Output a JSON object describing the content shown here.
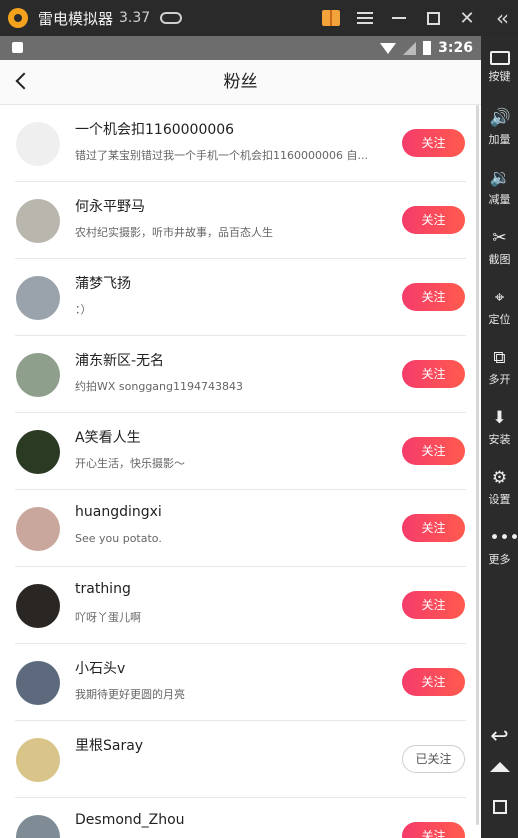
{
  "window": {
    "title": "雷电模拟器",
    "version": "3.37"
  },
  "status_bar": {
    "time": "3:26"
  },
  "header": {
    "title": "粉丝",
    "back_icon": "chevron-left-icon"
  },
  "followers": [
    {
      "name": "一个机会扣1160000006",
      "desc": "错过了某宝别错过我一个手机一个机会扣1160000006 自...",
      "button": "关注",
      "followed": false,
      "avatar_color": "#efefef"
    },
    {
      "name": "何永平野马",
      "desc": "农村纪实摄影，听市井故事，品百态人生",
      "button": "关注",
      "followed": false,
      "avatar_color": "#b9b6ae"
    },
    {
      "name": "蒲梦飞扬",
      "desc": "：）",
      "button": "关注",
      "followed": false,
      "avatar_color": "#9aa2ac"
    },
    {
      "name": "浦东新区-无名",
      "desc": "约拍WX  songgang1194743843",
      "button": "关注",
      "followed": false,
      "avatar_color": "#8ea08c"
    },
    {
      "name": "A笑看人生",
      "desc": "开心生活，快乐摄影～",
      "button": "关注",
      "followed": false,
      "avatar_color": "#2b3a22"
    },
    {
      "name": "huangdingxi",
      "desc": "See you potato.",
      "button": "关注",
      "followed": false,
      "avatar_color": "#c9a79c"
    },
    {
      "name": "trathing",
      "desc": "吖呀丫蛋儿啊",
      "button": "关注",
      "followed": false,
      "avatar_color": "#2a2624"
    },
    {
      "name": "小石头v",
      "desc": "我期待更好更圆的月亮",
      "button": "关注",
      "followed": false,
      "avatar_color": "#5d6a7e"
    },
    {
      "name": "里根Saray",
      "desc": "",
      "button": "已关注",
      "followed": true,
      "avatar_color": "#d9c48a"
    },
    {
      "name": "Desmond_Zhou",
      "desc": "",
      "button": "关注",
      "followed": false,
      "avatar_color": "#7f8c95"
    }
  ],
  "sidebar": {
    "items": [
      {
        "label": "按键",
        "icon": "keyboard-icon"
      },
      {
        "label": "加量",
        "icon": "volume-up-icon"
      },
      {
        "label": "减量",
        "icon": "volume-down-icon"
      },
      {
        "label": "截图",
        "icon": "scissors-icon"
      },
      {
        "label": "定位",
        "icon": "location-pin-icon"
      },
      {
        "label": "多开",
        "icon": "multi-instance-icon"
      },
      {
        "label": "安装",
        "icon": "apk-install-icon"
      },
      {
        "label": "设置",
        "icon": "gear-icon"
      },
      {
        "label": "更多",
        "icon": "more-dots-icon"
      }
    ]
  },
  "colors": {
    "accent": "#f53c6b",
    "titlebar": "#2a2a2a",
    "statusbar": "#6d6d6d"
  }
}
